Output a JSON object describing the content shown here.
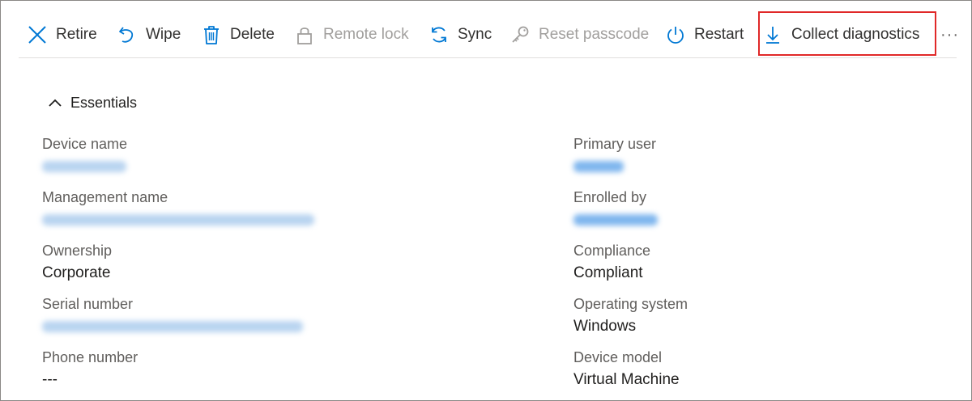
{
  "toolbar": {
    "retire": "Retire",
    "wipe": "Wipe",
    "delete": "Delete",
    "remote_lock": "Remote lock",
    "sync": "Sync",
    "reset_passcode": "Reset passcode",
    "restart": "Restart",
    "collect_diagnostics": "Collect diagnostics",
    "more": "···"
  },
  "essentials": {
    "title": "Essentials",
    "left": {
      "device_name_label": "Device name",
      "management_name_label": "Management name",
      "ownership_label": "Ownership",
      "ownership_value": "Corporate",
      "serial_number_label": "Serial number",
      "phone_number_label": "Phone number",
      "phone_number_value": "---"
    },
    "right": {
      "primary_user_label": "Primary user",
      "enrolled_by_label": "Enrolled by",
      "compliance_label": "Compliance",
      "compliance_value": "Compliant",
      "os_label": "Operating system",
      "os_value": "Windows",
      "device_model_label": "Device model",
      "device_model_value": "Virtual Machine"
    }
  },
  "colors": {
    "accent": "#0078d4",
    "highlight_border": "#e02828",
    "disabled_text": "#a19f9d"
  },
  "icons": {
    "retire": "close-x-icon",
    "wipe": "undo-icon",
    "delete": "trash-icon",
    "remote_lock": "lock-icon",
    "sync": "sync-icon",
    "reset_passcode": "key-icon",
    "restart": "power-icon",
    "collect_diagnostics": "download-icon",
    "essentials": "chevron-up-icon"
  }
}
